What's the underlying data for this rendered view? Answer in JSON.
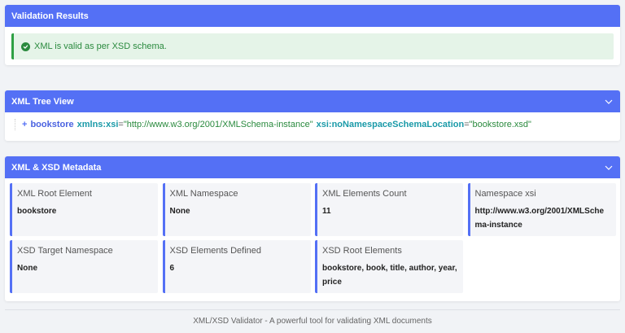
{
  "validation": {
    "title": "Validation Results",
    "message": "XML is valid as per XSD schema.",
    "success_color": "#2a8a3e"
  },
  "tree": {
    "title": "XML Tree View",
    "toggle": "+",
    "element": "bookstore",
    "attributes": [
      {
        "name": "xmlns:xsi",
        "value": "\"http://www.w3.org/2001/XMLSchema-instance\""
      },
      {
        "name": "xsi:noNamespaceSchemaLocation",
        "value": "\"bookstore.xsd\""
      }
    ]
  },
  "metadata": {
    "title": "XML & XSD Metadata",
    "items": [
      {
        "label": "XML Root Element",
        "value": "bookstore"
      },
      {
        "label": "XML Namespace",
        "value": "None"
      },
      {
        "label": "XML Elements Count",
        "value": "11"
      },
      {
        "label": "Namespace xsi",
        "value": "http://www.w3.org/2001/XMLSchema-instance"
      },
      {
        "label": "XSD Target Namespace",
        "value": "None"
      },
      {
        "label": "XSD Elements Defined",
        "value": "6"
      },
      {
        "label": "XSD Root Elements",
        "value": "bookstore, book, title, author, year, price"
      }
    ]
  },
  "footer": {
    "text": "XML/XSD Validator - A powerful tool for validating XML documents"
  },
  "colors": {
    "accent": "#5470f5",
    "background": "#f1f3f6"
  },
  "icons": {
    "success": "check-circle-icon",
    "collapse": "chevron-down-icon"
  }
}
